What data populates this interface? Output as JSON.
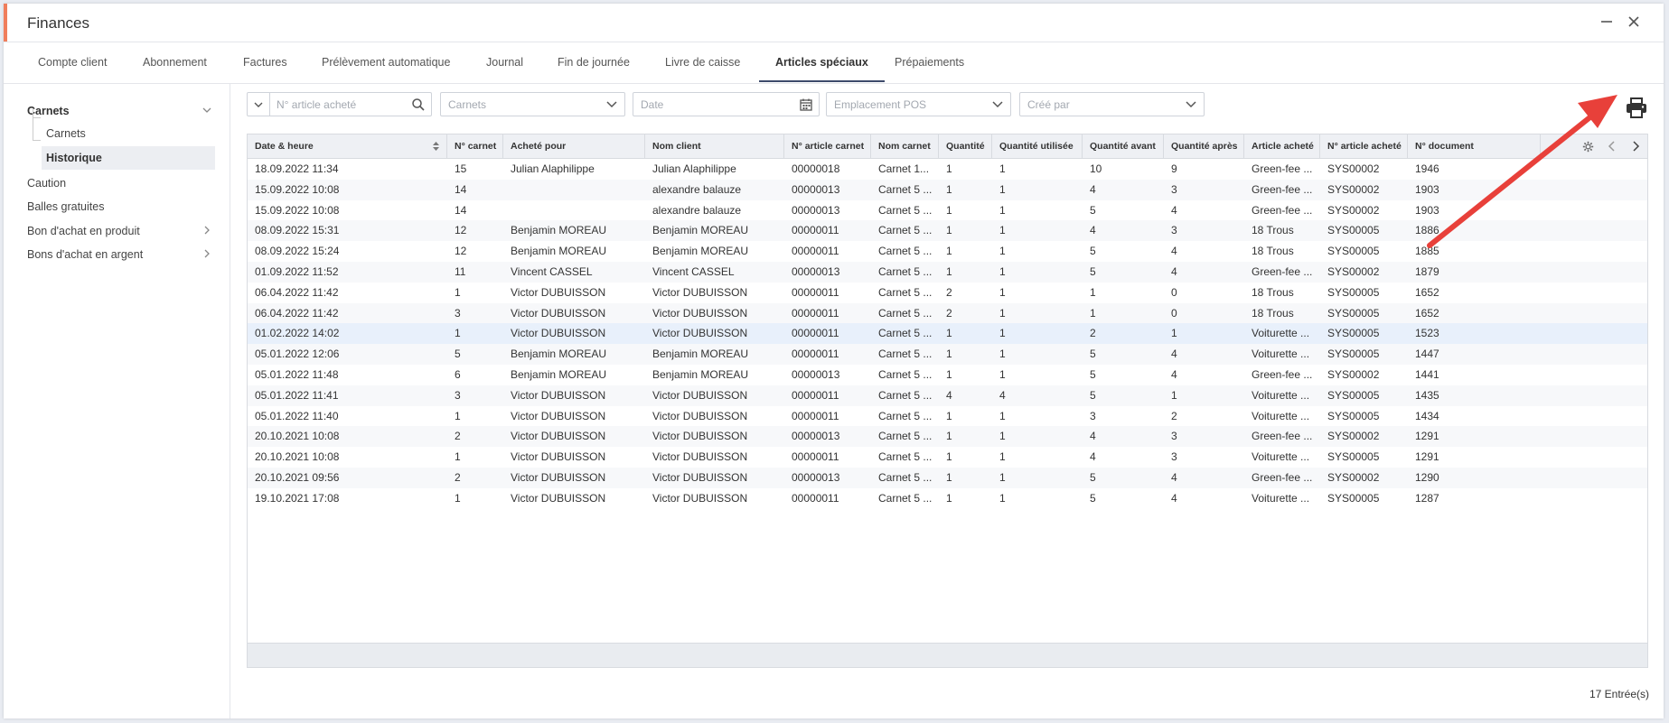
{
  "window": {
    "title": "Finances"
  },
  "tabs": [
    {
      "label": "Compte client"
    },
    {
      "label": "Abonnement"
    },
    {
      "label": "Factures"
    },
    {
      "label": "Prélèvement automatique"
    },
    {
      "label": "Journal"
    },
    {
      "label": "Fin de journée"
    },
    {
      "label": "Livre de caisse"
    },
    {
      "label": "Articles spéciaux"
    },
    {
      "label": "Prépaiements"
    }
  ],
  "active_tab": "Articles spéciaux",
  "sidebar": {
    "group": "Carnets",
    "sub_items": [
      {
        "label": "Carnets"
      },
      {
        "label": "Historique"
      }
    ],
    "items": [
      {
        "label": "Caution"
      },
      {
        "label": "Balles gratuites"
      },
      {
        "label": "Bon d'achat en produit"
      },
      {
        "label": "Bons d'achat en argent"
      }
    ]
  },
  "filters": {
    "article_placeholder": "N° article acheté",
    "carnets_placeholder": "Carnets",
    "date_placeholder": "Date",
    "pos_placeholder": "Emplacement POS",
    "cree_par_placeholder": "Créé par"
  },
  "table": {
    "columns": [
      "Date & heure",
      "N° carnet",
      "Acheté pour",
      "Nom client",
      "N° article carnet",
      "Nom carnet",
      "Quantité",
      "Quantité utilisée",
      "Quantité avant",
      "Quantité après",
      "Article acheté",
      "N° article acheté",
      "N° document"
    ],
    "rows": [
      [
        "18.09.2022 11:34",
        "15",
        "Julian Alaphilippe",
        "Julian Alaphilippe",
        "00000018",
        "Carnet 1...",
        "1",
        "1",
        "10",
        "9",
        "Green-fee ...",
        "SYS00002",
        "1946"
      ],
      [
        "15.09.2022 10:08",
        "14",
        "",
        "alexandre balauze",
        "00000013",
        "Carnet 5 ...",
        "1",
        "1",
        "4",
        "3",
        "Green-fee ...",
        "SYS00002",
        "1903"
      ],
      [
        "15.09.2022 10:08",
        "14",
        "",
        "alexandre balauze",
        "00000013",
        "Carnet 5 ...",
        "1",
        "1",
        "5",
        "4",
        "Green-fee ...",
        "SYS00002",
        "1903"
      ],
      [
        "08.09.2022 15:31",
        "12",
        "Benjamin MOREAU",
        "Benjamin MOREAU",
        "00000011",
        "Carnet 5 ...",
        "1",
        "1",
        "4",
        "3",
        "18 Trous",
        "SYS00005",
        "1886"
      ],
      [
        "08.09.2022 15:24",
        "12",
        "Benjamin MOREAU",
        "Benjamin MOREAU",
        "00000011",
        "Carnet 5 ...",
        "1",
        "1",
        "5",
        "4",
        "18 Trous",
        "SYS00005",
        "1885"
      ],
      [
        "01.09.2022 11:52",
        "11",
        "Vincent CASSEL",
        "Vincent CASSEL",
        "00000013",
        "Carnet 5 ...",
        "1",
        "1",
        "5",
        "4",
        "Green-fee ...",
        "SYS00002",
        "1879"
      ],
      [
        "06.04.2022 11:42",
        "1",
        "Victor DUBUISSON",
        "Victor DUBUISSON",
        "00000011",
        "Carnet 5 ...",
        "2",
        "1",
        "1",
        "0",
        "18 Trous",
        "SYS00005",
        "1652"
      ],
      [
        "06.04.2022 11:42",
        "3",
        "Victor DUBUISSON",
        "Victor DUBUISSON",
        "00000011",
        "Carnet 5 ...",
        "2",
        "1",
        "1",
        "0",
        "18 Trous",
        "SYS00005",
        "1652"
      ],
      [
        "01.02.2022 14:02",
        "1",
        "Victor DUBUISSON",
        "Victor DUBUISSON",
        "00000011",
        "Carnet 5 ...",
        "1",
        "1",
        "2",
        "1",
        "Voiturette ...",
        "SYS00005",
        "1523"
      ],
      [
        "05.01.2022 12:06",
        "5",
        "Benjamin MOREAU",
        "Benjamin MOREAU",
        "00000011",
        "Carnet 5 ...",
        "1",
        "1",
        "5",
        "4",
        "Voiturette ...",
        "SYS00005",
        "1447"
      ],
      [
        "05.01.2022 11:48",
        "6",
        "Benjamin MOREAU",
        "Benjamin MOREAU",
        "00000013",
        "Carnet 5 ...",
        "1",
        "1",
        "5",
        "4",
        "Green-fee ...",
        "SYS00002",
        "1441"
      ],
      [
        "05.01.2022 11:41",
        "3",
        "Victor DUBUISSON",
        "Victor DUBUISSON",
        "00000011",
        "Carnet 5 ...",
        "4",
        "4",
        "5",
        "1",
        "Voiturette ...",
        "SYS00005",
        "1435"
      ],
      [
        "05.01.2022 11:40",
        "1",
        "Victor DUBUISSON",
        "Victor DUBUISSON",
        "00000011",
        "Carnet 5 ...",
        "1",
        "1",
        "3",
        "2",
        "Voiturette ...",
        "SYS00005",
        "1434"
      ],
      [
        "20.10.2021 10:08",
        "2",
        "Victor DUBUISSON",
        "Victor DUBUISSON",
        "00000013",
        "Carnet 5 ...",
        "1",
        "1",
        "4",
        "3",
        "Green-fee ...",
        "SYS00002",
        "1291"
      ],
      [
        "20.10.2021 10:08",
        "1",
        "Victor DUBUISSON",
        "Victor DUBUISSON",
        "00000011",
        "Carnet 5 ...",
        "1",
        "1",
        "4",
        "3",
        "Voiturette ...",
        "SYS00005",
        "1291"
      ],
      [
        "20.10.2021 09:56",
        "2",
        "Victor DUBUISSON",
        "Victor DUBUISSON",
        "00000013",
        "Carnet 5 ...",
        "1",
        "1",
        "5",
        "4",
        "Green-fee ...",
        "SYS00002",
        "1290"
      ],
      [
        "19.10.2021 17:08",
        "1",
        "Victor DUBUISSON",
        "Victor DUBUISSON",
        "00000011",
        "Carnet 5 ...",
        "1",
        "1",
        "5",
        "4",
        "Voiturette ...",
        "SYS00005",
        "1287"
      ]
    ],
    "selected_row": 8
  },
  "footer": {
    "entries": "17 Entrée(s)"
  },
  "colors": {
    "accent": "#f07e5c",
    "annotation_arrow": "#e8403a",
    "selected_row": "#e8f0fb"
  }
}
